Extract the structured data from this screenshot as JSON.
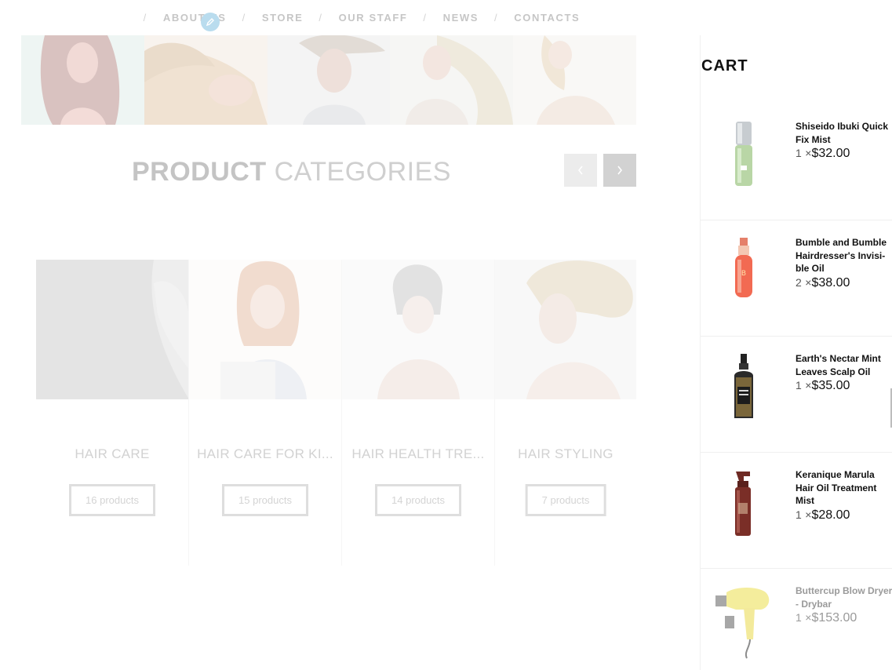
{
  "nav": {
    "items": [
      "ABOUT US",
      "STORE",
      "OUR STAFF",
      "NEWS",
      "CONTACTS"
    ],
    "separator": "/",
    "edit_icon": "pencil-icon"
  },
  "section": {
    "title_bold": "PRODUCT",
    "title_light": "CATEGORIES",
    "prev_icon": "chevron-left-icon",
    "next_icon": "chevron-right-icon"
  },
  "categories": [
    {
      "name": "HAIR CARE",
      "count": "16 products"
    },
    {
      "name": "HAIR CARE FOR KI...",
      "count": "15 products"
    },
    {
      "name": "HAIR HEALTH TRE...",
      "count": "14 products"
    },
    {
      "name": "HAIR STYLING",
      "count": "7 products"
    }
  ],
  "cart": {
    "title": "CART",
    "items": [
      {
        "name": "Shiseido Ibuki Quick Fix Mist",
        "qty": "1",
        "times": "×",
        "price": "$32.00"
      },
      {
        "name": "Bumble and Bumble Hairdresser's Invisi-ble Oil",
        "qty": "2",
        "times": "×",
        "price": "$38.00"
      },
      {
        "name": "Earth's Nectar Mint Leaves Scalp Oil",
        "qty": "1",
        "times": "×",
        "price": "$35.00"
      },
      {
        "name": "Keranique Marula Hair Oil Treatment Mist",
        "qty": "1",
        "times": "×",
        "price": "$28.00"
      },
      {
        "name": "Buttercup Blow Dryer - Drybar",
        "qty": "1",
        "times": "×",
        "price": "$153.00"
      }
    ]
  },
  "colors": {
    "faded_text": "#c6c6c6",
    "cart_text": "#111111",
    "edit_badge": "#b9dcee"
  }
}
